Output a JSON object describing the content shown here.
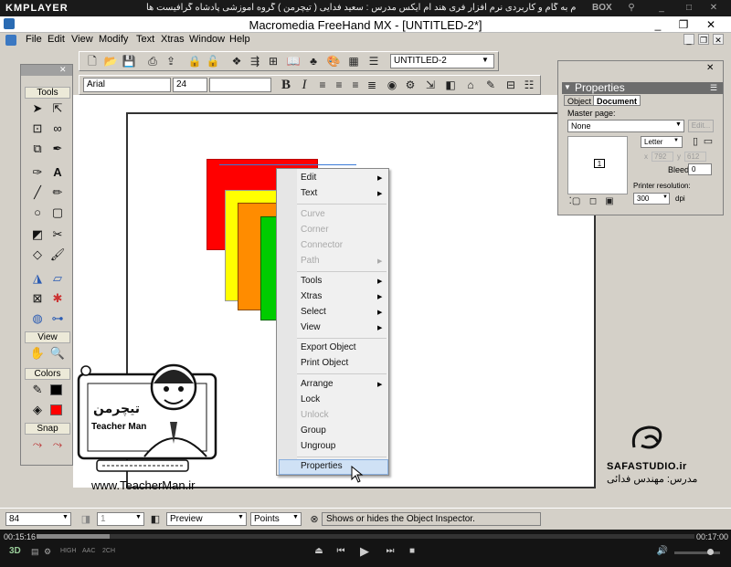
{
  "km": {
    "logo": "KMPLAYER",
    "banner": "مجموعه آموزشی جامع ، گام به گام و کاربردی نرم افزار فری هند ام ایکس   مدرس : سعید فدایی ( تیچرمن ) گروه آموزشی پادشاه گرافیست ها",
    "box_label": "BOX",
    "time_current": "00:15:16",
    "time_total": "00:17:00",
    "bottom_labels": [
      "3D",
      "HIGH",
      "AAC",
      "2CH"
    ]
  },
  "app": {
    "title": "Macromedia FreeHand MX - [UNTITLED-2*]",
    "menu": [
      "File",
      "Edit",
      "View",
      "Modify",
      "Text",
      "Xtras",
      "Window",
      "Help"
    ],
    "document_name": "UNTITLED-2",
    "font_name": "Arial",
    "font_size": "24"
  },
  "tools_panel": {
    "sections": [
      "Tools",
      "View",
      "Colors",
      "Snap"
    ]
  },
  "properties": {
    "title": "Properties",
    "tabs": [
      "Object",
      "Document"
    ],
    "master_page_label": "Master page:",
    "master_page_value": "None",
    "edit_label": "Edit...",
    "page_size": "Letter",
    "x_label": "x",
    "x_value": "792",
    "y_label": "y",
    "y_value": "612",
    "thumb_number": "1",
    "bleed_label": "Bleed:",
    "bleed_value": "0",
    "printer_res_label": "Printer resolution:",
    "printer_res_value": "300",
    "dpi_label": "dpi"
  },
  "context_menu": {
    "items": [
      {
        "label": "Edit",
        "submenu": true,
        "disabled": false
      },
      {
        "label": "Text",
        "submenu": true,
        "disabled": false
      },
      {
        "label": "Curve",
        "submenu": false,
        "disabled": true
      },
      {
        "label": "Corner",
        "submenu": false,
        "disabled": true
      },
      {
        "label": "Connector",
        "submenu": false,
        "disabled": true
      },
      {
        "label": "Path",
        "submenu": true,
        "disabled": true
      },
      {
        "label": "Tools",
        "submenu": true,
        "disabled": false
      },
      {
        "label": "Xtras",
        "submenu": true,
        "disabled": false
      },
      {
        "label": "Select",
        "submenu": true,
        "disabled": false
      },
      {
        "label": "View",
        "submenu": true,
        "disabled": false
      },
      {
        "label": "Export Object",
        "submenu": false,
        "disabled": false
      },
      {
        "label": "Print Object",
        "submenu": false,
        "disabled": false
      },
      {
        "label": "Arrange",
        "submenu": true,
        "disabled": false
      },
      {
        "label": "Lock",
        "submenu": false,
        "disabled": false
      },
      {
        "label": "Unlock",
        "submenu": false,
        "disabled": true
      },
      {
        "label": "Group",
        "submenu": false,
        "disabled": false
      },
      {
        "label": "Ungroup",
        "submenu": false,
        "disabled": false
      },
      {
        "label": "Properties",
        "submenu": false,
        "disabled": false
      }
    ]
  },
  "status": {
    "zoom": "84",
    "page": "1",
    "mode": "Preview",
    "units": "Points",
    "hint": "Shows or hides the Object Inspector."
  },
  "watermarks": {
    "teacherman_url": "www.TeacherMan.ir",
    "teacherman_caption": "Teacher Man",
    "safa_studio": "SAFASTUDIO.ir",
    "safa_caption": "مدرس: مهندس فدائی"
  },
  "colors": {
    "red": "#ff0000",
    "yellow": "#ffff00",
    "orange": "#ff8c00",
    "green": "#00cc00"
  }
}
